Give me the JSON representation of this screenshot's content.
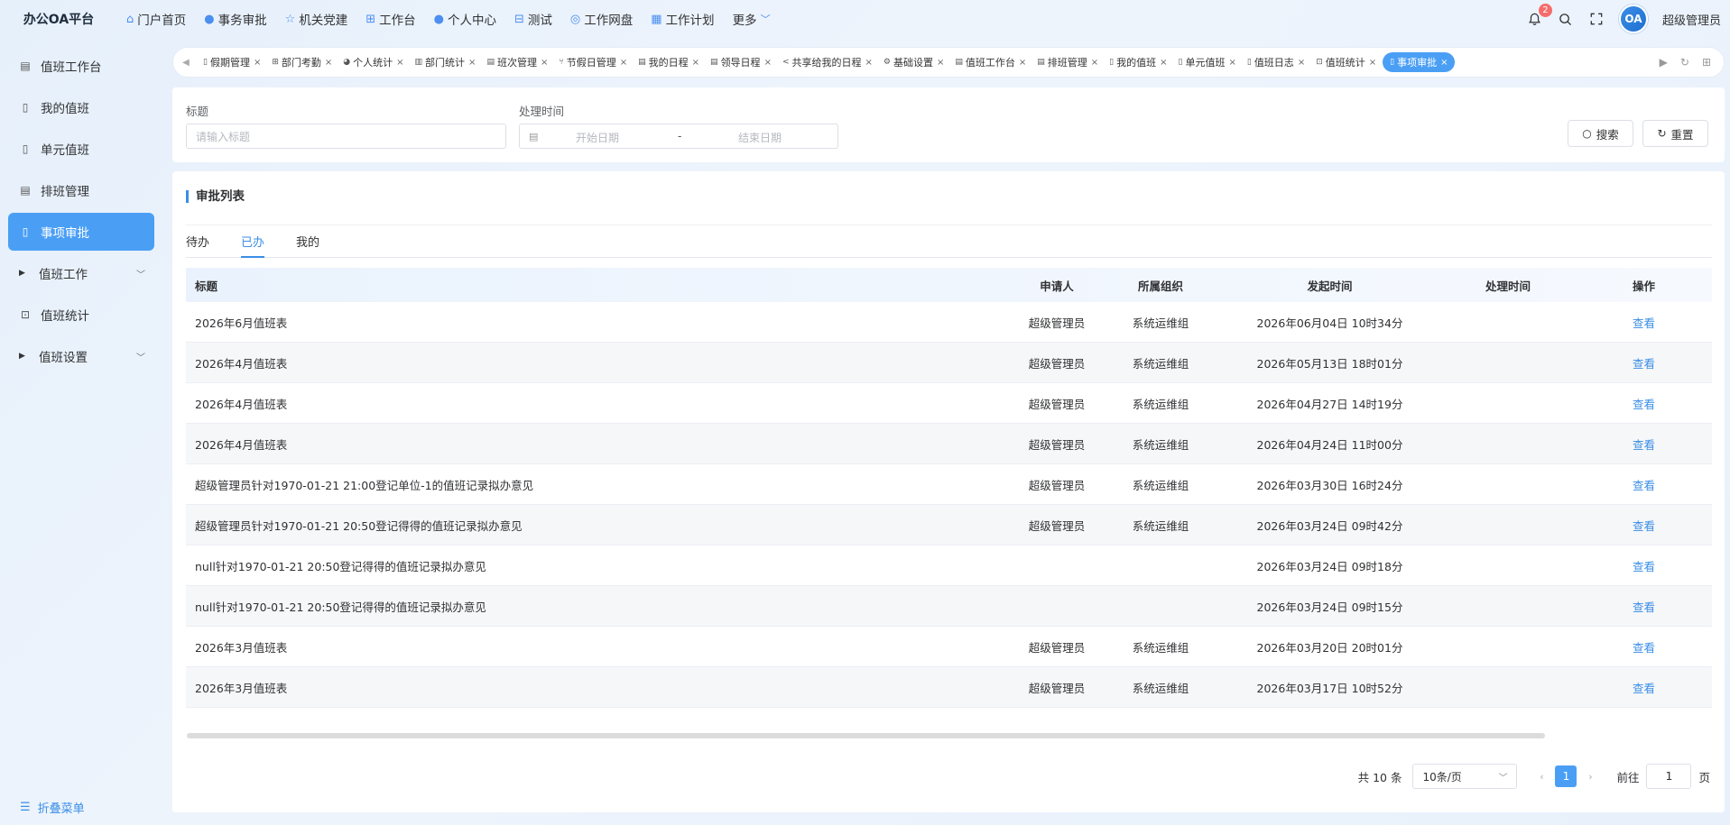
{
  "app": {
    "brand": "办公OA平台"
  },
  "topnav": [
    {
      "label": "门户首页",
      "icon": "home-icon"
    },
    {
      "label": "事务审批",
      "icon": "info-circle-icon"
    },
    {
      "label": "机关党建",
      "icon": "star-icon"
    },
    {
      "label": "工作台",
      "icon": "cluster-icon"
    },
    {
      "label": "个人中心",
      "icon": "user-icon"
    },
    {
      "label": "测试",
      "icon": "grid-icon"
    },
    {
      "label": "工作网盘",
      "icon": "database-icon"
    },
    {
      "label": "工作计划",
      "icon": "calendar-icon"
    }
  ],
  "topnav_more": "更多",
  "topright": {
    "notification_count": "2",
    "username": "超级管理员",
    "avatar_text": "OA"
  },
  "sidebar": {
    "items": [
      {
        "label": "值班工作台",
        "icon": "calendar-icon",
        "active": false
      },
      {
        "label": "我的值班",
        "icon": "document-icon",
        "active": false
      },
      {
        "label": "单元值班",
        "icon": "document-icon",
        "active": false
      },
      {
        "label": "排班管理",
        "icon": "calendar-icon",
        "active": false
      },
      {
        "label": "事项审批",
        "icon": "document-icon",
        "active": true
      },
      {
        "label": "值班工作",
        "icon": "caret-right-icon",
        "active": false,
        "expandable": true
      },
      {
        "label": "值班统计",
        "icon": "presentation-icon",
        "active": false
      },
      {
        "label": "值班设置",
        "icon": "caret-right-icon",
        "active": false,
        "expandable": true
      }
    ],
    "collapse_label": "折叠菜单"
  },
  "tabs": [
    {
      "label": "假期管理",
      "icon": "document-icon"
    },
    {
      "label": "部门考勤",
      "icon": "cluster-icon"
    },
    {
      "label": "个人统计",
      "icon": "pie-icon"
    },
    {
      "label": "部门统计",
      "icon": "bar-icon"
    },
    {
      "label": "班次管理",
      "icon": "calendar-icon"
    },
    {
      "label": "节假日管理",
      "icon": "branch-icon"
    },
    {
      "label": "我的日程",
      "icon": "calendar-icon"
    },
    {
      "label": "领导日程",
      "icon": "calendar-icon"
    },
    {
      "label": "共享给我的日程",
      "icon": "share-icon"
    },
    {
      "label": "基础设置",
      "icon": "gear-icon"
    },
    {
      "label": "值班工作台",
      "icon": "calendar-icon"
    },
    {
      "label": "排班管理",
      "icon": "calendar-icon"
    },
    {
      "label": "我的值班",
      "icon": "document-icon"
    },
    {
      "label": "单元值班",
      "icon": "document-icon"
    },
    {
      "label": "值班日志",
      "icon": "document-icon"
    },
    {
      "label": "值班统计",
      "icon": "presentation-icon"
    },
    {
      "label": "事项审批",
      "icon": "document-icon",
      "active": true
    }
  ],
  "filter": {
    "title_label": "标题",
    "title_placeholder": "请输入标题",
    "time_label": "处理时间",
    "start_placeholder": "开始日期",
    "range_sep": "-",
    "end_placeholder": "结束日期",
    "search_label": "搜索",
    "reset_label": "重置"
  },
  "main": {
    "section_title": "审批列表",
    "subtabs": [
      {
        "label": "待办",
        "active": false
      },
      {
        "label": "已办",
        "active": true
      },
      {
        "label": "我的",
        "active": false
      }
    ],
    "columns": [
      "标题",
      "申请人",
      "所属组织",
      "发起时间",
      "处理时间",
      "操作"
    ],
    "rows": [
      {
        "title": "2026年6月值班表",
        "applicant": "超级管理员",
        "org": "系统运维组",
        "start": "2026年06月04日 10时34分",
        "processed": "",
        "action": "查看"
      },
      {
        "title": "2026年4月值班表",
        "applicant": "超级管理员",
        "org": "系统运维组",
        "start": "2026年05月13日 18时01分",
        "processed": "",
        "action": "查看"
      },
      {
        "title": "2026年4月值班表",
        "applicant": "超级管理员",
        "org": "系统运维组",
        "start": "2026年04月27日 14时19分",
        "processed": "",
        "action": "查看"
      },
      {
        "title": "2026年4月值班表",
        "applicant": "超级管理员",
        "org": "系统运维组",
        "start": "2026年04月24日 11时00分",
        "processed": "",
        "action": "查看"
      },
      {
        "title": "超级管理员针对1970-01-21 21:00登记单位-1的值班记录拟办意见",
        "applicant": "超级管理员",
        "org": "系统运维组",
        "start": "2026年03月30日 16时24分",
        "processed": "",
        "action": "查看"
      },
      {
        "title": "超级管理员针对1970-01-21 20:50登记得得的值班记录拟办意见",
        "applicant": "超级管理员",
        "org": "系统运维组",
        "start": "2026年03月24日 09时42分",
        "processed": "",
        "action": "查看"
      },
      {
        "title": "null针对1970-01-21 20:50登记得得的值班记录拟办意见",
        "applicant": "",
        "org": "",
        "start": "2026年03月24日 09时18分",
        "processed": "",
        "action": "查看"
      },
      {
        "title": "null针对1970-01-21 20:50登记得得的值班记录拟办意见",
        "applicant": "",
        "org": "",
        "start": "2026年03月24日 09时15分",
        "processed": "",
        "action": "查看"
      },
      {
        "title": "2026年3月值班表",
        "applicant": "超级管理员",
        "org": "系统运维组",
        "start": "2026年03月20日 20时01分",
        "processed": "",
        "action": "查看"
      },
      {
        "title": "2026年3月值班表",
        "applicant": "超级管理员",
        "org": "系统运维组",
        "start": "2026年03月17日 10时52分",
        "processed": "",
        "action": "查看"
      }
    ]
  },
  "pager": {
    "total": "共 10 条",
    "page_size": "10条/页",
    "current_page": "1",
    "goto_label": "前往",
    "goto_value": "1",
    "page_suffix": "页"
  },
  "colors": {
    "accent": "#4a9ff5",
    "link": "#3a8ee6",
    "badge": "#f56c6c"
  }
}
